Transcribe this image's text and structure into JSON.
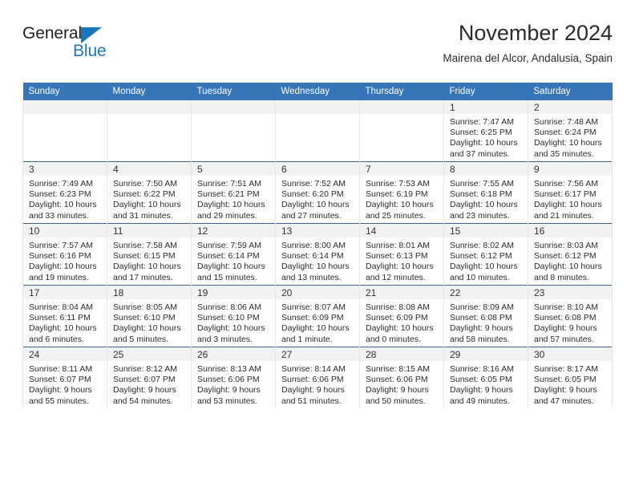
{
  "brand": {
    "name_part1": "General",
    "name_part2": "Blue",
    "triangle_color": "#1878be",
    "text_color": "#231f20"
  },
  "header": {
    "title": "November 2024",
    "subtitle": "Mairena del Alcor, Andalusia, Spain"
  },
  "theme": {
    "header_bar_color": "#3575b8",
    "daynum_band_color": "#f2f2f2",
    "row_divider_color": "#41658a"
  },
  "weekday_headers": [
    "Sunday",
    "Monday",
    "Tuesday",
    "Wednesday",
    "Thursday",
    "Friday",
    "Saturday"
  ],
  "labels": {
    "sunrise_prefix": "Sunrise:",
    "sunset_prefix": "Sunset:",
    "daylight_prefix": "Daylight:"
  },
  "weeks": [
    [
      {
        "empty": true
      },
      {
        "empty": true
      },
      {
        "empty": true
      },
      {
        "empty": true
      },
      {
        "empty": true
      },
      {
        "day": "1",
        "sunrise": "Sunrise: 7:47 AM",
        "sunset": "Sunset: 6:25 PM",
        "daylight": "Daylight: 10 hours and 37 minutes."
      },
      {
        "day": "2",
        "sunrise": "Sunrise: 7:48 AM",
        "sunset": "Sunset: 6:24 PM",
        "daylight": "Daylight: 10 hours and 35 minutes."
      }
    ],
    [
      {
        "day": "3",
        "sunrise": "Sunrise: 7:49 AM",
        "sunset": "Sunset: 6:23 PM",
        "daylight": "Daylight: 10 hours and 33 minutes."
      },
      {
        "day": "4",
        "sunrise": "Sunrise: 7:50 AM",
        "sunset": "Sunset: 6:22 PM",
        "daylight": "Daylight: 10 hours and 31 minutes."
      },
      {
        "day": "5",
        "sunrise": "Sunrise: 7:51 AM",
        "sunset": "Sunset: 6:21 PM",
        "daylight": "Daylight: 10 hours and 29 minutes."
      },
      {
        "day": "6",
        "sunrise": "Sunrise: 7:52 AM",
        "sunset": "Sunset: 6:20 PM",
        "daylight": "Daylight: 10 hours and 27 minutes."
      },
      {
        "day": "7",
        "sunrise": "Sunrise: 7:53 AM",
        "sunset": "Sunset: 6:19 PM",
        "daylight": "Daylight: 10 hours and 25 minutes."
      },
      {
        "day": "8",
        "sunrise": "Sunrise: 7:55 AM",
        "sunset": "Sunset: 6:18 PM",
        "daylight": "Daylight: 10 hours and 23 minutes."
      },
      {
        "day": "9",
        "sunrise": "Sunrise: 7:56 AM",
        "sunset": "Sunset: 6:17 PM",
        "daylight": "Daylight: 10 hours and 21 minutes."
      }
    ],
    [
      {
        "day": "10",
        "sunrise": "Sunrise: 7:57 AM",
        "sunset": "Sunset: 6:16 PM",
        "daylight": "Daylight: 10 hours and 19 minutes."
      },
      {
        "day": "11",
        "sunrise": "Sunrise: 7:58 AM",
        "sunset": "Sunset: 6:15 PM",
        "daylight": "Daylight: 10 hours and 17 minutes."
      },
      {
        "day": "12",
        "sunrise": "Sunrise: 7:59 AM",
        "sunset": "Sunset: 6:14 PM",
        "daylight": "Daylight: 10 hours and 15 minutes."
      },
      {
        "day": "13",
        "sunrise": "Sunrise: 8:00 AM",
        "sunset": "Sunset: 6:14 PM",
        "daylight": "Daylight: 10 hours and 13 minutes."
      },
      {
        "day": "14",
        "sunrise": "Sunrise: 8:01 AM",
        "sunset": "Sunset: 6:13 PM",
        "daylight": "Daylight: 10 hours and 12 minutes."
      },
      {
        "day": "15",
        "sunrise": "Sunrise: 8:02 AM",
        "sunset": "Sunset: 6:12 PM",
        "daylight": "Daylight: 10 hours and 10 minutes."
      },
      {
        "day": "16",
        "sunrise": "Sunrise: 8:03 AM",
        "sunset": "Sunset: 6:12 PM",
        "daylight": "Daylight: 10 hours and 8 minutes."
      }
    ],
    [
      {
        "day": "17",
        "sunrise": "Sunrise: 8:04 AM",
        "sunset": "Sunset: 6:11 PM",
        "daylight": "Daylight: 10 hours and 6 minutes."
      },
      {
        "day": "18",
        "sunrise": "Sunrise: 8:05 AM",
        "sunset": "Sunset: 6:10 PM",
        "daylight": "Daylight: 10 hours and 5 minutes."
      },
      {
        "day": "19",
        "sunrise": "Sunrise: 8:06 AM",
        "sunset": "Sunset: 6:10 PM",
        "daylight": "Daylight: 10 hours and 3 minutes."
      },
      {
        "day": "20",
        "sunrise": "Sunrise: 8:07 AM",
        "sunset": "Sunset: 6:09 PM",
        "daylight": "Daylight: 10 hours and 1 minute."
      },
      {
        "day": "21",
        "sunrise": "Sunrise: 8:08 AM",
        "sunset": "Sunset: 6:09 PM",
        "daylight": "Daylight: 10 hours and 0 minutes."
      },
      {
        "day": "22",
        "sunrise": "Sunrise: 8:09 AM",
        "sunset": "Sunset: 6:08 PM",
        "daylight": "Daylight: 9 hours and 58 minutes."
      },
      {
        "day": "23",
        "sunrise": "Sunrise: 8:10 AM",
        "sunset": "Sunset: 6:08 PM",
        "daylight": "Daylight: 9 hours and 57 minutes."
      }
    ],
    [
      {
        "day": "24",
        "sunrise": "Sunrise: 8:11 AM",
        "sunset": "Sunset: 6:07 PM",
        "daylight": "Daylight: 9 hours and 55 minutes."
      },
      {
        "day": "25",
        "sunrise": "Sunrise: 8:12 AM",
        "sunset": "Sunset: 6:07 PM",
        "daylight": "Daylight: 9 hours and 54 minutes."
      },
      {
        "day": "26",
        "sunrise": "Sunrise: 8:13 AM",
        "sunset": "Sunset: 6:06 PM",
        "daylight": "Daylight: 9 hours and 53 minutes."
      },
      {
        "day": "27",
        "sunrise": "Sunrise: 8:14 AM",
        "sunset": "Sunset: 6:06 PM",
        "daylight": "Daylight: 9 hours and 51 minutes."
      },
      {
        "day": "28",
        "sunrise": "Sunrise: 8:15 AM",
        "sunset": "Sunset: 6:06 PM",
        "daylight": "Daylight: 9 hours and 50 minutes."
      },
      {
        "day": "29",
        "sunrise": "Sunrise: 8:16 AM",
        "sunset": "Sunset: 6:05 PM",
        "daylight": "Daylight: 9 hours and 49 minutes."
      },
      {
        "day": "30",
        "sunrise": "Sunrise: 8:17 AM",
        "sunset": "Sunset: 6:05 PM",
        "daylight": "Daylight: 9 hours and 47 minutes."
      }
    ]
  ]
}
